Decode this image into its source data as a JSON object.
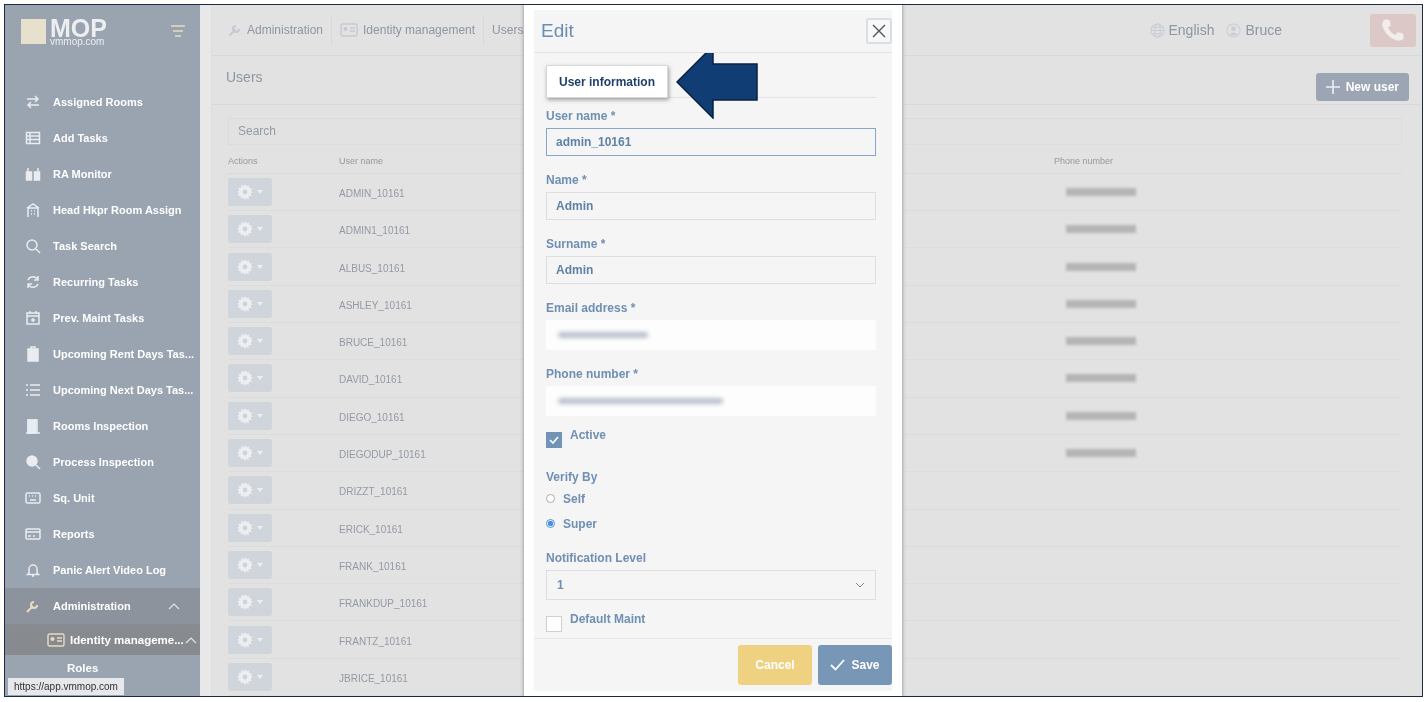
{
  "sidebar": {
    "logo": {
      "mark": "MOP",
      "subtext": "vmmop.com"
    },
    "items": [
      {
        "label": "Assigned Rooms"
      },
      {
        "label": "Add Tasks"
      },
      {
        "label": "RA Monitor"
      },
      {
        "label": "Head Hkpr Room Assign"
      },
      {
        "label": "Task Search"
      },
      {
        "label": "Recurring Tasks"
      },
      {
        "label": "Prev. Maint Tasks"
      },
      {
        "label": "Upcoming Rent Days Tas..."
      },
      {
        "label": "Upcoming Next Days Tas..."
      },
      {
        "label": "Rooms Inspection"
      },
      {
        "label": "Process Inspection"
      },
      {
        "label": "Sq. Unit"
      },
      {
        "label": "Reports"
      },
      {
        "label": "Panic Alert Video Log"
      },
      {
        "label": "Administration",
        "expanded": true,
        "children": [
          {
            "label": "Identity manageme...",
            "expanded": true,
            "children": [
              {
                "label": "Roles"
              }
            ]
          }
        ]
      }
    ],
    "status_url": "https://app.vmmop.com"
  },
  "header": {
    "breadcrumb": [
      "Administration",
      "Identity management",
      "Users"
    ],
    "language": "English",
    "user": "Bruce"
  },
  "page": {
    "title": "Users",
    "new_button": "New user",
    "search": {
      "placeholder": "Search"
    },
    "table": {
      "columns": [
        "Actions",
        "User name",
        "Phone number"
      ],
      "rows": [
        {
          "user_name": "ADMIN_10161",
          "phone_blurred": true
        },
        {
          "user_name": "ADMIN1_10161",
          "phone_blurred": true
        },
        {
          "user_name": "ALBUS_10161",
          "phone_blurred": true
        },
        {
          "user_name": "ASHLEY_10161",
          "phone_blurred": true
        },
        {
          "user_name": "BRUCE_10161",
          "phone_blurred": true
        },
        {
          "user_name": "DAVID_10161",
          "phone_blurred": true
        },
        {
          "user_name": "DIEGO_10161",
          "phone_blurred": true
        },
        {
          "user_name": "DIEGODUP_10161",
          "phone_blurred": true
        },
        {
          "user_name": "DRIZZT_10161",
          "phone_blurred": false
        },
        {
          "user_name": "ERICK_10161",
          "phone_blurred": false
        },
        {
          "user_name": "FRANK_10161",
          "phone_blurred": false
        },
        {
          "user_name": "FRANKDUP_10161",
          "phone_blurred": false
        },
        {
          "user_name": "FRANTZ_10161",
          "phone_blurred": false
        },
        {
          "user_name": "JBRICE_10161",
          "phone_blurred": false
        }
      ]
    }
  },
  "modal": {
    "title": "Edit",
    "tabs": [
      {
        "label": "User information",
        "selected": true
      }
    ],
    "fields": [
      {
        "kind": "text",
        "label": "User name *",
        "value": "admin_10161",
        "focused": true
      },
      {
        "kind": "text",
        "label": "Name *",
        "value": "Admin",
        "focused": false
      },
      {
        "kind": "text",
        "label": "Surname *",
        "value": "Admin",
        "focused": false
      },
      {
        "kind": "blurred",
        "label": "Email address *"
      },
      {
        "kind": "blurred",
        "label": "Phone number *"
      },
      {
        "kind": "checkbox",
        "label": "Active",
        "checked": true
      },
      {
        "kind": "radio",
        "label": "Verify By",
        "options": [
          {
            "label": "Self",
            "selected": false
          },
          {
            "label": "Super",
            "selected": true
          }
        ]
      },
      {
        "kind": "select",
        "label": "Notification Level",
        "value": "1"
      },
      {
        "kind": "checkbox",
        "label": "Default Maint",
        "checked": false
      }
    ],
    "buttons": [
      {
        "kind": "cancel",
        "label": "Cancel"
      },
      {
        "kind": "save",
        "label": "Save"
      }
    ]
  }
}
